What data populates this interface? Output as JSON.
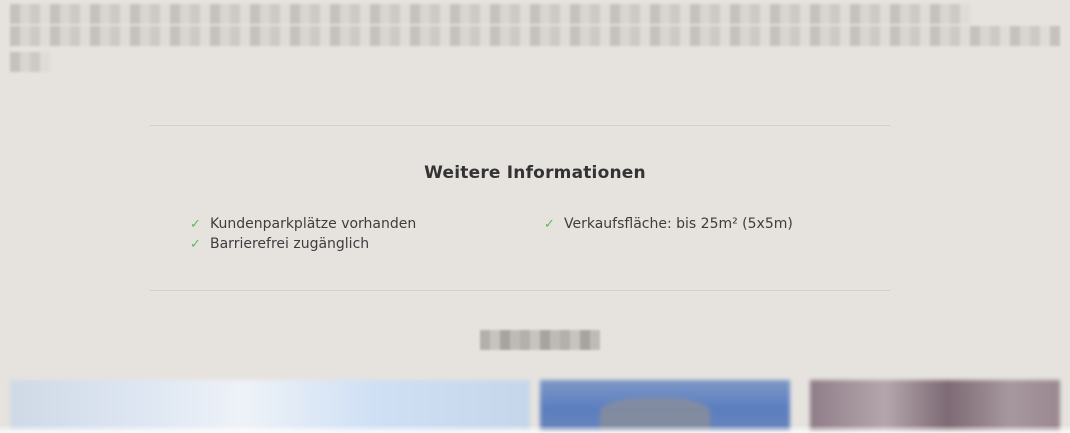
{
  "info": {
    "title": "Weitere Informationen",
    "features_left": [
      "Kundenparkplätze vorhanden",
      "Barrierefrei zugänglich"
    ],
    "features_right": [
      "Verkaufsfläche: bis 25m² (5x5m)"
    ]
  },
  "icons": {
    "check": "check-icon",
    "check_color": "#5cb85c"
  },
  "colors": {
    "background": "#e6e3df",
    "divider": "#d4d0cb",
    "title_text": "#333333"
  }
}
